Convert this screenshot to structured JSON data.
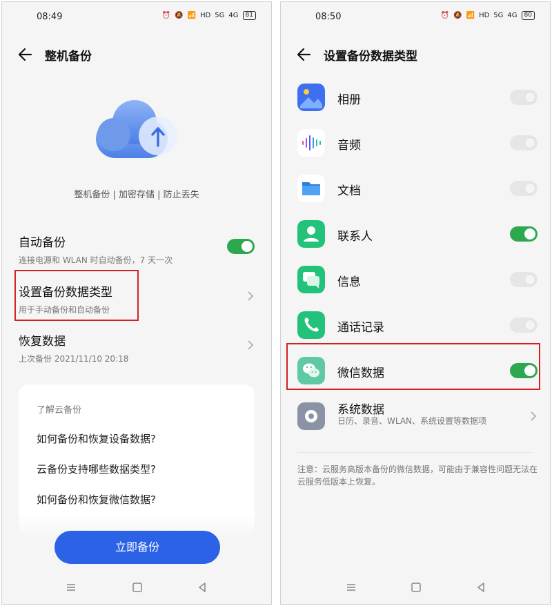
{
  "left": {
    "status": {
      "time": "08:49",
      "network": "HD",
      "signal1": "5G",
      "signal2": "4G",
      "battery": "81"
    },
    "title": "整机备份",
    "tagline": "整机备份 | 加密存储 | 防止丢失",
    "auto_backup": {
      "title": "自动备份",
      "subtitle": "连接电源和 WLAN 时自动备份，7 天一次",
      "enabled": true
    },
    "data_type": {
      "title": "设置备份数据类型",
      "subtitle": "用于手动备份和自动备份"
    },
    "restore": {
      "title": "恢复数据",
      "subtitle": "上次备份 2021/11/10 20:18"
    },
    "learn": {
      "heading": "了解云备份",
      "links": [
        "如何备份和恢复设备数据?",
        "云备份支持哪些数据类型?",
        "如何备份和恢复微信数据?"
      ]
    },
    "primary_button": "立即备份"
  },
  "right": {
    "status": {
      "time": "08:50",
      "network": "HD",
      "signal1": "5G",
      "signal2": "4G",
      "battery": "80"
    },
    "title": "设置备份数据类型",
    "items": [
      {
        "label": "相册",
        "enabled": false,
        "icon": "gallery-icon"
      },
      {
        "label": "音频",
        "enabled": false,
        "icon": "audio-icon"
      },
      {
        "label": "文档",
        "enabled": false,
        "icon": "folder-icon"
      },
      {
        "label": "联系人",
        "enabled": true,
        "icon": "contacts-icon"
      },
      {
        "label": "信息",
        "enabled": false,
        "icon": "messages-icon"
      },
      {
        "label": "通话记录",
        "enabled": false,
        "icon": "phone-icon"
      },
      {
        "label": "微信数据",
        "enabled": true,
        "icon": "wechat-icon"
      }
    ],
    "system": {
      "title": "系统数据",
      "subtitle": "日历、录音、WLAN、系统设置等数据项"
    },
    "note": "注意：云服务高版本备份的微信数据，可能由于兼容性问题无法在云服务低版本上恢复。"
  },
  "colors": {
    "accent_green": "#2ea84f",
    "primary_blue": "#2c63e6",
    "highlight_red": "#d42020"
  }
}
